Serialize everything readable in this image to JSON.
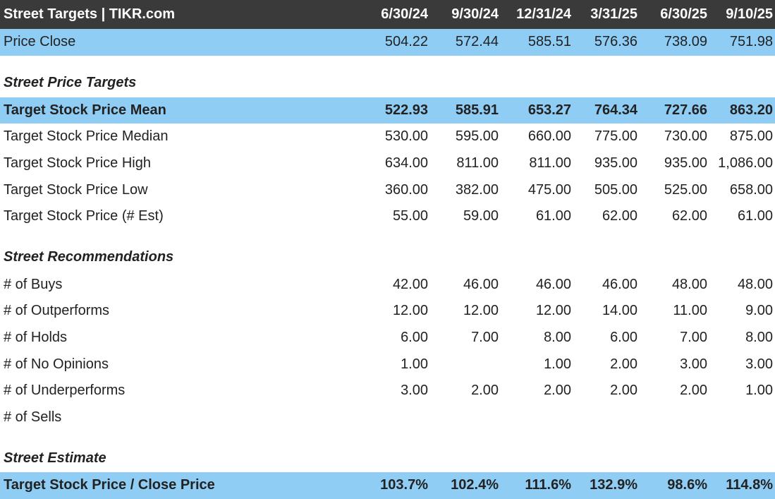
{
  "header": {
    "title": "Street Targets | TIKR.com",
    "columns": [
      "6/30/24",
      "9/30/24",
      "12/31/24",
      "3/31/25",
      "6/30/25",
      "9/10/25"
    ]
  },
  "price_close": {
    "label": "Price Close",
    "values": [
      "504.22",
      "572.44",
      "585.51",
      "576.36",
      "738.09",
      "751.98"
    ]
  },
  "sections": {
    "targets": "Street Price Targets",
    "recommendations": "Street Recommendations",
    "estimate": "Street Estimate"
  },
  "targets": [
    {
      "label": "Target Stock Price Mean",
      "values": [
        "522.93",
        "585.91",
        "653.27",
        "764.34",
        "727.66",
        "863.20"
      ]
    },
    {
      "label": "Target Stock Price Median",
      "values": [
        "530.00",
        "595.00",
        "660.00",
        "775.00",
        "730.00",
        "875.00"
      ]
    },
    {
      "label": "Target Stock Price High",
      "values": [
        "634.00",
        "811.00",
        "811.00",
        "935.00",
        "935.00",
        "1,086.00"
      ]
    },
    {
      "label": "Target Stock Price Low",
      "values": [
        "360.00",
        "382.00",
        "475.00",
        "505.00",
        "525.00",
        "658.00"
      ]
    },
    {
      "label": "Target Stock Price (# Est)",
      "values": [
        "55.00",
        "59.00",
        "61.00",
        "62.00",
        "62.00",
        "61.00"
      ]
    }
  ],
  "recommendations": [
    {
      "label": "# of Buys",
      "values": [
        "42.00",
        "46.00",
        "46.00",
        "46.00",
        "48.00",
        "48.00"
      ]
    },
    {
      "label": "# of Outperforms",
      "values": [
        "12.00",
        "12.00",
        "12.00",
        "14.00",
        "11.00",
        "9.00"
      ]
    },
    {
      "label": "# of Holds",
      "values": [
        "6.00",
        "7.00",
        "8.00",
        "6.00",
        "7.00",
        "8.00"
      ]
    },
    {
      "label": "# of No Opinions",
      "values": [
        "1.00",
        "",
        "1.00",
        "2.00",
        "3.00",
        "3.00"
      ]
    },
    {
      "label": "# of Underperforms",
      "values": [
        "3.00",
        "2.00",
        "2.00",
        "2.00",
        "2.00",
        "1.00"
      ]
    },
    {
      "label": "# of Sells",
      "values": [
        "",
        "",
        "",
        "",
        "",
        ""
      ]
    }
  ],
  "estimate": [
    {
      "label": "Target Stock Price / Close Price",
      "values": [
        "103.7%",
        "102.4%",
        "111.6%",
        "132.9%",
        "98.6%",
        "114.8%"
      ]
    }
  ]
}
